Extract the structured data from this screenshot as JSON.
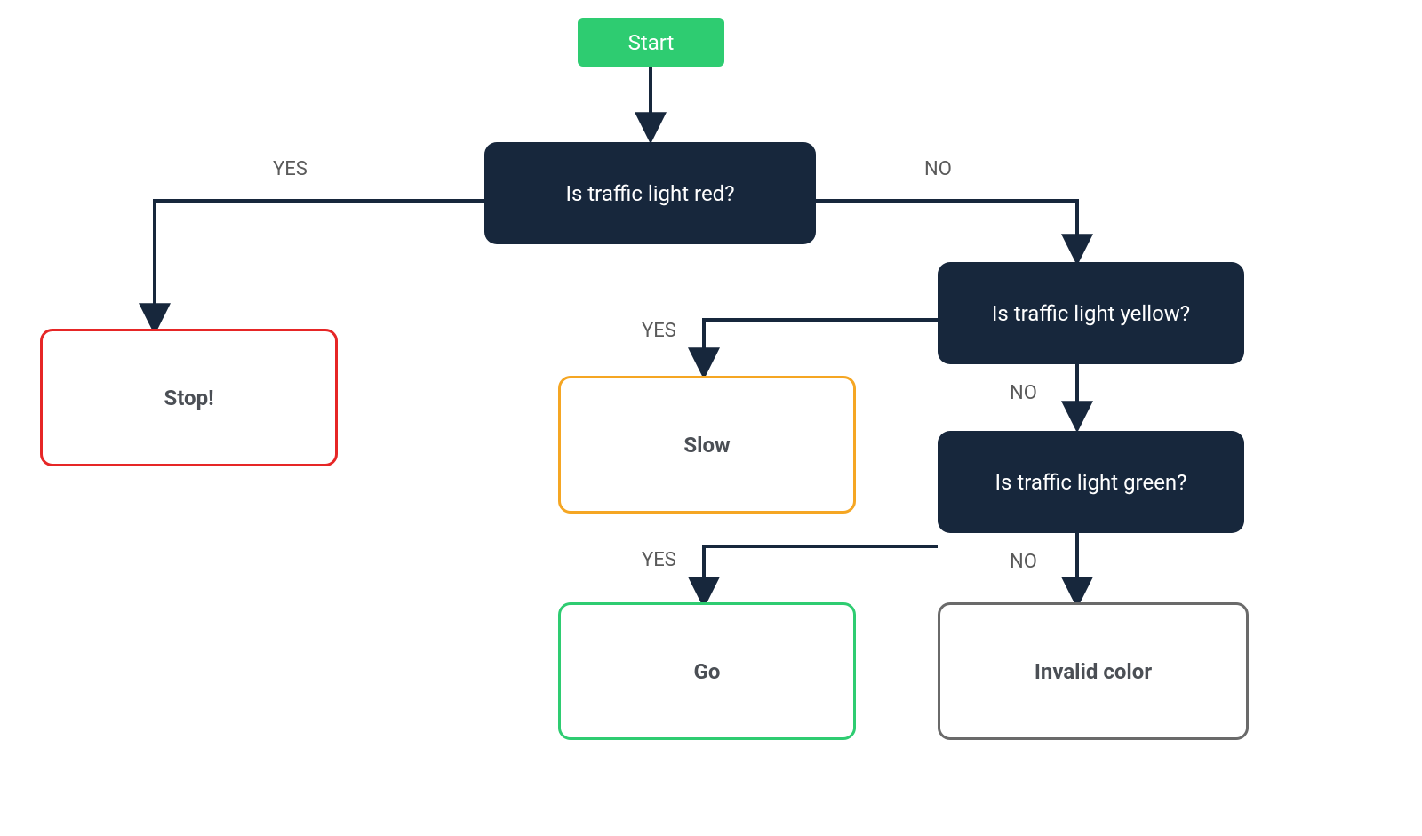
{
  "colors": {
    "start_bg": "#2ECC71",
    "decision_bg": "#17273C",
    "text_dark": "#4B4F55",
    "text_light": "#ffffff",
    "edge": "#17273C",
    "stop_border": "#E62626",
    "slow_border": "#F5A623",
    "go_border": "#2ECC71",
    "invalid_border": "#6A6A6A"
  },
  "nodes": {
    "start": "Start",
    "d1": "Is traffic light red?",
    "d2": "Is traffic light yellow?",
    "d3": "Is traffic light green?",
    "stop": "Stop!",
    "slow": "Slow",
    "go": "Go",
    "invalid": "Invalid color"
  },
  "labels": {
    "yes": "YES",
    "no": "NO"
  },
  "chart_data": {
    "type": "flowchart",
    "nodes": [
      {
        "id": "start",
        "kind": "terminator",
        "label": "Start"
      },
      {
        "id": "d1",
        "kind": "decision",
        "label": "Is traffic light red?"
      },
      {
        "id": "stop",
        "kind": "process",
        "label": "Stop!",
        "border": "red"
      },
      {
        "id": "d2",
        "kind": "decision",
        "label": "Is traffic light yellow?"
      },
      {
        "id": "slow",
        "kind": "process",
        "label": "Slow",
        "border": "orange"
      },
      {
        "id": "d3",
        "kind": "decision",
        "label": "Is traffic light green?"
      },
      {
        "id": "go",
        "kind": "process",
        "label": "Go",
        "border": "green"
      },
      {
        "id": "invalid",
        "kind": "process",
        "label": "Invalid color",
        "border": "gray"
      }
    ],
    "edges": [
      {
        "from": "start",
        "to": "d1",
        "label": null
      },
      {
        "from": "d1",
        "to": "stop",
        "label": "YES"
      },
      {
        "from": "d1",
        "to": "d2",
        "label": "NO"
      },
      {
        "from": "d2",
        "to": "slow",
        "label": "YES"
      },
      {
        "from": "d2",
        "to": "d3",
        "label": "NO"
      },
      {
        "from": "d3",
        "to": "go",
        "label": "YES"
      },
      {
        "from": "d3",
        "to": "invalid",
        "label": "NO"
      }
    ]
  }
}
